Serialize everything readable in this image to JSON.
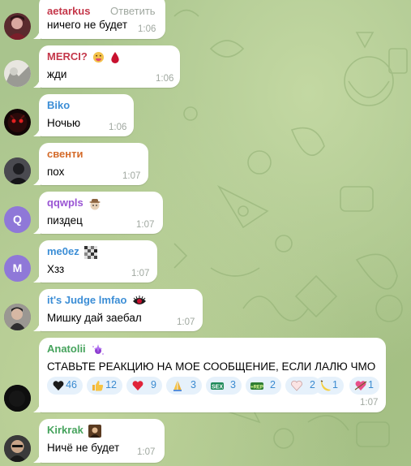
{
  "theme": {
    "background": "#a9c48d",
    "bubble": "#ffffff",
    "time": "#a0a8a0",
    "reaction_bg": "#e6f1fb",
    "reaction_count": "#3a8ad0"
  },
  "messages": [
    {
      "sender": "aetarkus",
      "sender_color": "#c4374a",
      "text": "ничего не будет",
      "time": "1:06",
      "reply_label": "Ответить"
    },
    {
      "sender": "MERCI?",
      "sender_color": "#c4374a",
      "badges": [
        "tongue-emoji-icon",
        "blood-drop-emoji-icon"
      ],
      "text": "жди",
      "time": "1:06"
    },
    {
      "sender": "Biko",
      "sender_color": "#3c8ed6",
      "text": "Ночью",
      "time": "1:06"
    },
    {
      "sender": "свенти",
      "sender_color": "#d46b2a",
      "text": "пох",
      "time": "1:07"
    },
    {
      "sender": "qqwpls",
      "sender_color": "#9a55d4",
      "badges": [
        "cowboy-emoji-icon"
      ],
      "text": "пиздец",
      "time": "1:07",
      "avatar_letter": "Q",
      "avatar_color": "#8f78d8"
    },
    {
      "sender": "me0ez",
      "sender_color": "#3c8ed6",
      "badges": [
        "pixel-badge-icon"
      ],
      "text": "Хзз",
      "time": "1:07",
      "avatar_letter": "M",
      "avatar_color": "#8f78d8"
    },
    {
      "sender": "it's Judge lmfao",
      "sender_color": "#3c8ed6",
      "badges": [
        "eye-badge-icon"
      ],
      "text": "Мишку дай заебал",
      "time": "1:07"
    },
    {
      "sender": "Anatolii",
      "sender_color": "#46a35d",
      "badges": [
        "sparkle-badge-icon"
      ],
      "text": "СТАВЬТЕ РЕАКЦИЮ НА МОЕ СООБЩЕНИЕ, ЕСЛИ ЛАЛЮ ЧМО",
      "time": "1:07"
    },
    {
      "sender": "Kirkrak",
      "sender_color": "#46a35d",
      "badges": [
        "portrait-badge-icon"
      ],
      "text": "Ничё не будет",
      "time": "1:07"
    }
  ],
  "reactions": [
    {
      "icon": "black-heart-icon",
      "count": "46"
    },
    {
      "icon": "thumbs-up-icon",
      "count": "12"
    },
    {
      "icon": "red-heart-icon",
      "count": "9"
    },
    {
      "icon": "folded-hands-icon",
      "count": "3"
    },
    {
      "icon": "sex-sticker-icon",
      "count": "3"
    },
    {
      "icon": "rep-sticker-icon",
      "count": "2"
    },
    {
      "icon": "white-heart-icon",
      "count": "2"
    },
    {
      "icon": "banana-icon",
      "count": "1"
    },
    {
      "icon": "heart-arrow-icon",
      "count": "1"
    }
  ]
}
